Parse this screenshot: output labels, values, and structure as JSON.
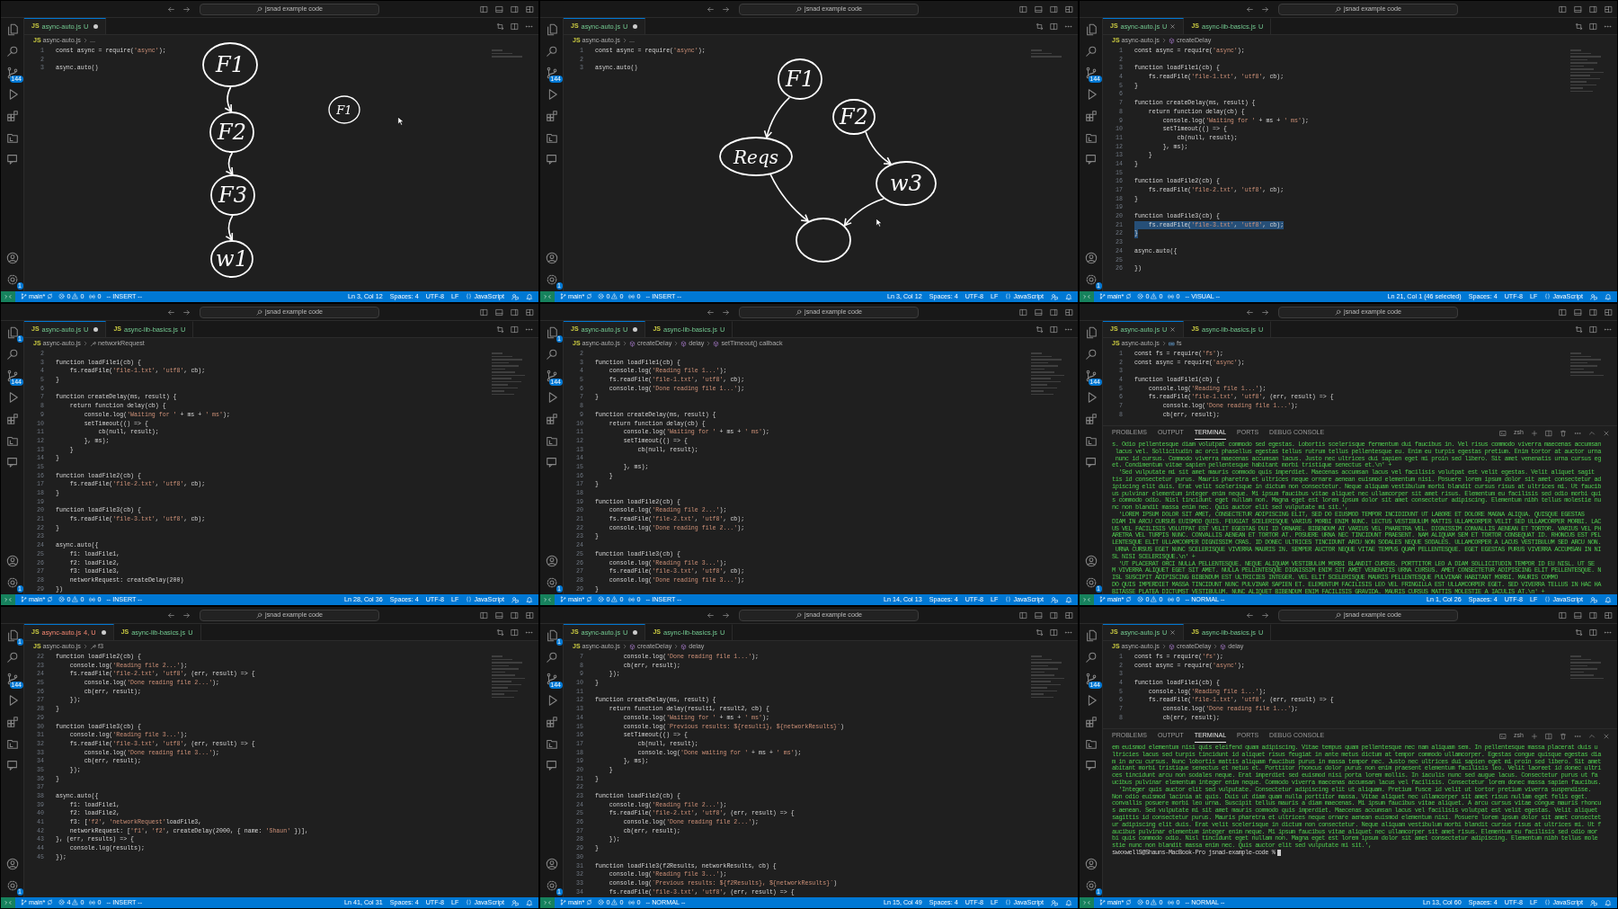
{
  "window": {
    "titles": [
      "jsnad example code",
      "jsnad example code",
      "jsnad example code",
      "jsnad example code",
      "jsnad example code",
      "jsnad example code",
      "jsnad example code",
      "jsnad example code",
      "jsnad example code"
    ]
  },
  "panels": [
    {
      "tabs": [
        {
          "icon": "JS",
          "label": "async-auto.js",
          "status": "U",
          "kind": "untracked",
          "selected": true,
          "dirty": true
        }
      ],
      "breadcrumb": [
        {
          "kind": "file",
          "icon": "JS",
          "label": "async-auto.js"
        },
        {
          "kind": "plain",
          "label": "..."
        }
      ],
      "badges": {
        "scm": "144",
        "settings": "1"
      },
      "lines": [
        [
          "1",
          "const async = require('async');"
        ],
        [
          "2"
        ],
        [
          "3",
          "async.auto()"
        ]
      ],
      "drawing": {
        "nodes": [
          {
            "kind": "big",
            "label": "F1"
          },
          {
            "kind": "big",
            "label": "F2"
          },
          {
            "kind": "big",
            "label": "F3"
          },
          {
            "kind": "big",
            "label": "w1"
          },
          {
            "kind": "small",
            "label": "F1"
          }
        ],
        "edges": [
          {
            "kind": "arrow"
          },
          {
            "kind": "arrow"
          },
          {
            "kind": "arrow"
          }
        ]
      },
      "status": {
        "branch": "main*",
        "errors": "0",
        "warnings": "0",
        "ports": "0",
        "mode": "-- INSERT --",
        "position": "Ln 3, Col 12",
        "spaces": "Spaces: 4",
        "encoding": "UTF-8",
        "eol": "LF",
        "language": "JavaScript"
      }
    },
    {
      "tabs": [
        {
          "icon": "JS",
          "label": "async-auto.js",
          "status": "U",
          "kind": "untracked",
          "selected": true,
          "dirty": true
        }
      ],
      "breadcrumb": [
        {
          "kind": "file",
          "icon": "JS",
          "label": "async-auto.js"
        },
        {
          "kind": "plain",
          "label": "..."
        }
      ],
      "badges": {
        "scm": "144",
        "settings": "1"
      },
      "lines": [
        [
          "1",
          "const async = require('async');"
        ],
        [
          "2"
        ],
        [
          "3",
          "async.auto()"
        ]
      ],
      "drawing": {
        "nodes": [
          {
            "kind": "big",
            "label": "F1"
          },
          {
            "kind": "big",
            "label": "F2"
          },
          {
            "kind": "big",
            "label": "Reqs"
          },
          {
            "kind": "big",
            "label": "w3"
          },
          {
            "kind": "empty"
          }
        ],
        "edges": [
          {
            "kind": "arrow"
          },
          {
            "kind": "arrow"
          },
          {
            "kind": "arrow"
          },
          {
            "kind": "arrow"
          }
        ]
      },
      "status": {
        "branch": "main*",
        "errors": "0",
        "warnings": "0",
        "ports": "0",
        "mode": "-- INSERT --",
        "position": "Ln 3, Col 12",
        "spaces": "Spaces: 4",
        "encoding": "UTF-8",
        "eol": "LF",
        "language": "JavaScript"
      }
    },
    {
      "tabs": [
        {
          "icon": "JS",
          "label": "async-auto.js",
          "status": "U",
          "kind": "untracked",
          "selected": true,
          "dirty": false
        },
        {
          "icon": "JS",
          "label": "async-lib-basics.js",
          "status": "U",
          "kind": "untracked",
          "selected": false,
          "dirty": false
        }
      ],
      "breadcrumb": [
        {
          "kind": "file",
          "icon": "JS",
          "label": "async-auto.js"
        },
        {
          "kind": "function",
          "label": "createDelay"
        }
      ],
      "badges": {
        "scm": "144",
        "settings": "1"
      },
      "lines": [
        [
          "1",
          "const async = require('async');"
        ],
        [
          "2"
        ],
        [
          "3",
          "function loadFile1(cb) {"
        ],
        [
          "4",
          "    fs.readFile('file-1.txt', 'utf8', cb);"
        ],
        [
          "5",
          "}"
        ],
        [
          "6"
        ],
        [
          "7",
          "function createDelay(ms, result) {"
        ],
        [
          "8",
          "    return function delay(cb) {"
        ],
        [
          "9",
          "        console.log('Waiting for ' + ms + ' ms');"
        ],
        [
          "10",
          "        setTimeout(() => {"
        ],
        [
          "11",
          "            cb(null, result);"
        ],
        [
          "12",
          "        }, ms);"
        ],
        [
          "13",
          "    }"
        ],
        [
          "14",
          "}"
        ],
        [
          "15"
        ],
        [
          "16",
          "function loadFile2(cb) {"
        ],
        [
          "17",
          "    fs.readFile('file-2.txt', 'utf8', cb);"
        ],
        [
          "18",
          "}"
        ],
        [
          "19"
        ],
        [
          "20",
          "function loadFile3(cb) {"
        ],
        [
          "21",
          "    fs.readFile('file-3.txt', 'utf8', cb);",
          true
        ],
        [
          "22",
          "}",
          true
        ],
        [
          "23"
        ],
        [
          "24",
          "async.auto({"
        ],
        [
          "25"
        ],
        [
          "26",
          "})"
        ]
      ],
      "status": {
        "branch": "main*",
        "errors": "0",
        "warnings": "0",
        "ports": "0",
        "mode": "-- VISUAL --",
        "position": "Ln 21, Col 1 (46 selected)",
        "spaces": "Spaces: 4",
        "encoding": "UTF-8",
        "eol": "LF",
        "language": "JavaScript"
      }
    },
    {
      "tabs": [
        {
          "icon": "JS",
          "label": "async-auto.js",
          "status": "U",
          "kind": "untracked",
          "selected": true,
          "dirty": true
        },
        {
          "icon": "JS",
          "label": "async-lib-basics.js",
          "status": "U",
          "kind": "untracked",
          "selected": false,
          "dirty": false
        }
      ],
      "breadcrumb": [
        {
          "kind": "file",
          "icon": "JS",
          "label": "async-auto.js"
        },
        {
          "kind": "property",
          "label": "networkRequest"
        }
      ],
      "badges": {
        "explorer": "1",
        "scm": "144",
        "settings": "1"
      },
      "lines": [
        [
          "2"
        ],
        [
          "3",
          "function loadFile1(cb) {"
        ],
        [
          "4",
          "    fs.readFile('file-1.txt', 'utf8', cb);"
        ],
        [
          "5",
          "}"
        ],
        [
          "6"
        ],
        [
          "7",
          "function createDelay(ms, result) {"
        ],
        [
          "8",
          "    return function delay(cb) {"
        ],
        [
          "9",
          "        console.log('Waiting for ' + ms + ' ms');"
        ],
        [
          "10",
          "        setTimeout(() => {"
        ],
        [
          "11",
          "            cb(null, result);"
        ],
        [
          "12",
          "        }, ms);"
        ],
        [
          "13",
          "    }"
        ],
        [
          "14",
          "}"
        ],
        [
          "15"
        ],
        [
          "16",
          "function loadFile2(cb) {"
        ],
        [
          "17",
          "    fs.readFile('file-2.txt', 'utf8', cb);"
        ],
        [
          "18",
          "}"
        ],
        [
          "19"
        ],
        [
          "20",
          "function loadFile3(cb) {"
        ],
        [
          "21",
          "    fs.readFile('file-3.txt', 'utf8', cb);"
        ],
        [
          "22",
          "}"
        ],
        [
          "23"
        ],
        [
          "24",
          "async.auto({"
        ],
        [
          "25",
          "    f1: loadFile1,"
        ],
        [
          "26",
          "    f2: loadFile2,"
        ],
        [
          "27",
          "    f3: loadFile3,"
        ],
        [
          "28",
          "    networkRequest: createDelay(200)"
        ],
        [
          "29",
          "})"
        ]
      ],
      "status": {
        "branch": "main*",
        "errors": "0",
        "warnings": "0",
        "ports": "0",
        "mode": "-- INSERT --",
        "position": "Ln 28, Col 36",
        "spaces": "Spaces: 4",
        "encoding": "UTF-8",
        "eol": "LF",
        "language": "JavaScript"
      }
    },
    {
      "tabs": [
        {
          "icon": "JS",
          "label": "async-auto.js",
          "status": "U",
          "kind": "untracked",
          "selected": true,
          "dirty": true
        },
        {
          "icon": "JS",
          "label": "async-lib-basics.js",
          "status": "U",
          "kind": "untracked",
          "selected": false,
          "dirty": false
        }
      ],
      "breadcrumb": [
        {
          "kind": "file",
          "icon": "JS",
          "label": "async-auto.js"
        },
        {
          "kind": "function",
          "label": "createDelay"
        },
        {
          "kind": "function",
          "label": "delay"
        },
        {
          "kind": "function",
          "label": "setTimeout() callback"
        }
      ],
      "badges": {
        "explorer": "1",
        "scm": "144",
        "settings": "1"
      },
      "lines": [
        [
          "2"
        ],
        [
          "3",
          "function loadFile1(cb) {"
        ],
        [
          "4",
          "    console.log('Reading file 1...');"
        ],
        [
          "5",
          "    fs.readFile('file-1.txt', 'utf8', cb);"
        ],
        [
          "6",
          "    console.log('Done reading file 1...');"
        ],
        [
          "7",
          "}"
        ],
        [
          "8"
        ],
        [
          "9",
          "function createDelay(ms, result) {"
        ],
        [
          "10",
          "    return function delay(cb) {"
        ],
        [
          "11",
          "        console.log('Waiting for ' + ms + ' ms');"
        ],
        [
          "12",
          "        setTimeout(() => {"
        ],
        [
          "13",
          "            cb(null, result);"
        ],
        [
          "14"
        ],
        [
          "15",
          "        }, ms);"
        ],
        [
          "16",
          "    }"
        ],
        [
          "17",
          "}"
        ],
        [
          "18"
        ],
        [
          "19",
          "function loadFile2(cb) {"
        ],
        [
          "20",
          "    console.log('Reading file 2...');"
        ],
        [
          "21",
          "    fs.readFile('file-2.txt', 'utf8', cb);"
        ],
        [
          "22",
          "    console.log('Done reading file 2...');"
        ],
        [
          "23",
          "}"
        ],
        [
          "24"
        ],
        [
          "25",
          "function loadFile3(cb) {"
        ],
        [
          "26",
          "    console.log('Reading file 3...');"
        ],
        [
          "27",
          "    fs.readFile('file-3.txt', 'utf8', cb);"
        ],
        [
          "28",
          "    console.log('Done reading file 3...');"
        ],
        [
          "29",
          "}"
        ]
      ],
      "status": {
        "branch": "main*",
        "errors": "0",
        "warnings": "0",
        "ports": "0",
        "mode": "-- INSERT --",
        "position": "Ln 14, Col 13",
        "spaces": "Spaces: 4",
        "encoding": "UTF-8",
        "eol": "LF",
        "language": "JavaScript"
      }
    },
    {
      "tabs": [
        {
          "icon": "JS",
          "label": "async-auto.js",
          "status": "U",
          "kind": "untracked",
          "selected": true,
          "dirty": false
        },
        {
          "icon": "JS",
          "label": "async-lib-basics.js",
          "status": "U",
          "kind": "untracked",
          "selected": false,
          "dirty": false
        }
      ],
      "breadcrumb": [
        {
          "kind": "file",
          "icon": "JS",
          "label": "async-auto.js"
        },
        {
          "kind": "variable",
          "label": "fs"
        }
      ],
      "badges": {
        "scm": "144",
        "settings": "1"
      },
      "lines": [
        [
          "1",
          "const fs = require('fs');"
        ],
        [
          "2",
          "const async = require('async');"
        ],
        [
          "3"
        ],
        [
          "4",
          "function loadFile1(cb) {"
        ],
        [
          "5",
          "    console.log('Reading file 1...');"
        ],
        [
          "6",
          "    fs.readFile('file-1.txt', 'utf8', (err, result) => {"
        ],
        [
          "7",
          "        console.log('Done reading file 1...');"
        ],
        [
          "8",
          "        cb(err, result);"
        ]
      ],
      "terminal": {
        "tabs": [
          {
            "label": "PROBLEMS",
            "selected": false
          },
          {
            "label": "OUTPUT",
            "selected": false
          },
          {
            "label": "TERMINAL",
            "selected": true
          },
          {
            "label": "PORTS",
            "selected": false
          },
          {
            "label": "DEBUG CONSOLE",
            "selected": false
          }
        ],
        "shell": "zsh",
        "lines": [
          "s. Odio pellentesque diam volutpat commodo sed egestas. Lobortis scelerisque fermentum dui faucibus in. Vel risus commodo viverra maecenas accumsan",
          " lacus vel. Sollicitudin ac orci phasellus egestas tellus rutrum tellus pellentesque eu. Enim eu turpis egestas pretium. Enim tortor at auctor urna",
          " nunc id cursus. Commodo viverra maecenas accumsan lacus. Justo nec ultrices dui sapien eget mi proin sed libero. Sit amet venenatis urna cursus eg",
          "et. Condimentum vitae sapien pellentesque habitant morbi tristique senectus et.\\n' +",
          "  'Sed vulputate mi sit amet mauris commodo quis imperdiet. Maecenas accumsan lacus vel facilisis volutpat est velit egestas. Velit aliquet sagit",
          "tis id consectetur purus. Mauris pharetra et ultrices neque ornare aenean euismod elementum nisi. Posuere lorem ipsum dolor sit amet consectetur ad",
          "ipiscing elit duis. Erat velit scelerisque in dictum non consectetur. Neque aliquam vestibulum morbi blandit cursus risus at ultrices mi. Ut faucib",
          "us pulvinar elementum integer enim neque. Mi ipsum faucibus vitae aliquet nec ullamcorper sit amet risus. Elementum eu facilisis sed odio morbi qui",
          "s commodo odio. Nisl tincidunt eget nullam non. Magna eget est lorem ipsum dolor sit amet consectetur adipiscing. Elementum nibh tellus molestie nu",
          "nc non blandit massa enim nec. Quis auctor elit sed vulputate mi sit.',",
          "  'LOREM IPSUM DOLOR SIT AMET, CONSECTETUR ADIPISCING ELIT, SED DO EIUSMOD TEMPOR INCIDIDUNT UT LABORE ET DOLORE MAGNA ALIQUA. QUISQUE EGESTAS",
          "DIAM IN ARCU CURSUS EUISMOD QUIS. FEUGIAT SCELERISQUE VARIUS MORBI ENIM NUNC. LECTUS VESTIBULUM MATTIS ULLAMCORPER VELIT SED ULLAMCORPER MORBI. LAC",
          "US VEL FACILISIS VOLUTPAT EST VELIT EGESTAS DUI ID ORNARE. BIBENDUM AT VARIUS VEL PHARETRA VEL. DIGNISSIM CONVALLIS AENEAN ET TORTOR. VARIUS VEL PH",
          "ARETRA VEL TURPIS NUNC. CONVALLIS AENEAN ET TORTOR AT. POSUERE URNA NEC TINCIDUNT PRAESENT. NAM ALIQUAM SEM ET TORTOR CONSEQUAT ID. RHONCUS EST PEL",
          "LENTESQUE ELIT ULLAMCORPER DIGNISSIM CRAS. ID DONEC ULTRICES TINCIDUNT ARCU NON SODALES NEQUE SODALES. ULLAMCORPER A LACUS VESTIBULUM SED ARCU NON.",
          " URNA CURSUS EGET NUNC SCELERISQUE VIVERRA MAURIS IN. SEMPER AUCTOR NEQUE VITAE TEMPUS QUAM PELLENTESQUE. EGET EGESTAS PURUS VIVERRA ACCUMSAN IN NI",
          "SL NISI SCELERISQUE.\\n' +",
          "  'UT PLACERAT ORCI NULLA PELLENTESQUE. NEQUE ALIQUAM VESTIBULUM MORBI BLANDIT CURSUS. PORTTITOR LEO A DIAM SOLLICITUDIN TEMPOR ID EU NISL. UT SE",
          "M VIVERRA ALIQUET EGET SIT AMET. NULLA PELLENTESQUE DIGNISSIM ENIM SIT AMET VENENATIS URNA CURSUS. AMET CONSECTETUR ADIPISCING ELIT PELLENTESQUE. N",
          "ISL SUSCIPIT ADIPISCING BIBENDUM EST ULTRICIES INTEGER. VEL ELIT SCELERISQUE MAURIS PELLENTESQUE PULVINAR HABITANT MORBI. MAURIS COMMO",
          "DO QUIS IMPERDIET MASSA TINCIDUNT NUNC PULVINAR SAPIEN ET. ELEMENTUM FACILISIS LEO VEL FRINGILLA EST ULLAMCORPER EGET. SED VIVERRA TELLUS IN HAC HA",
          "BITASSE PLATEA DICTUMST VESTIBULUM. NUNC ALIQUET BIBENDUM ENIM FACILISIS GRAVIDA. MAURIS CURSUS MATTIS MOLESTIE A IACULIS AT.\\n' +"
        ]
      },
      "status": {
        "branch": "main*",
        "errors": "0",
        "warnings": "0",
        "ports": "0",
        "mode": "-- NORMAL --",
        "position": "Ln 1, Col 26",
        "spaces": "Spaces: 4",
        "encoding": "UTF-8",
        "eol": "LF",
        "language": "JavaScript"
      }
    },
    {
      "tabs": [
        {
          "icon": "JS",
          "label": "async-auto.js",
          "status": "4, U",
          "kind": "error",
          "selected": true,
          "dirty": true
        },
        {
          "icon": "JS",
          "label": "async-lib-basics.js",
          "status": "U",
          "kind": "untracked",
          "selected": false,
          "dirty": false
        }
      ],
      "breadcrumb": [
        {
          "kind": "file",
          "icon": "JS",
          "label": "async-auto.js"
        },
        {
          "kind": "property",
          "label": "f3"
        }
      ],
      "badges": {
        "explorer": "1",
        "scm": "144",
        "settings": "1"
      },
      "lines": [
        [
          "22",
          "function loadFile2(cb) {"
        ],
        [
          "23",
          "    console.log('Reading file 2...');"
        ],
        [
          "24",
          "    fs.readFile('file-2.txt', 'utf8', (err, result) => {"
        ],
        [
          "25",
          "        console.log('Done reading file 2...');"
        ],
        [
          "26",
          "        cb(err, result);"
        ],
        [
          "27",
          "    });"
        ],
        [
          "28",
          "}"
        ],
        [
          "29"
        ],
        [
          "30",
          "function loadFile3(cb) {"
        ],
        [
          "31",
          "    console.log('Reading file 3...');"
        ],
        [
          "32",
          "    fs.readFile('file-3.txt', 'utf8', (err, result) => {"
        ],
        [
          "33",
          "        console.log('Done reading file 3...');"
        ],
        [
          "34",
          "        cb(err, result);"
        ],
        [
          "35",
          "    });"
        ],
        [
          "36",
          "}"
        ],
        [
          "37"
        ],
        [
          "38",
          "async.auto({"
        ],
        [
          "39",
          "    f1: loadFile1,"
        ],
        [
          "40",
          "    f2: loadFile2,"
        ],
        [
          "41",
          "    f3: ['f2', 'networkRequest'loadFile3,"
        ],
        [
          "42",
          "    networkRequest: ['f1', 'f2', createDelay(2000, { name: 'Shaun' })],"
        ],
        [
          "43",
          "}, (err, results) => {"
        ],
        [
          "44",
          "    console.log(results);"
        ],
        [
          "45",
          "});"
        ]
      ],
      "status": {
        "branch": "main*",
        "errors": "4",
        "warnings": "0",
        "ports": "0",
        "mode": "-- INSERT --",
        "position": "Ln 41, Col 31",
        "spaces": "Spaces: 4",
        "encoding": "UTF-8",
        "eol": "LF",
        "language": "JavaScript"
      }
    },
    {
      "tabs": [
        {
          "icon": "JS",
          "label": "async-auto.js",
          "status": "U",
          "kind": "untracked",
          "selected": true,
          "dirty": true
        },
        {
          "icon": "JS",
          "label": "async-lib-basics.js",
          "status": "U",
          "kind": "untracked",
          "selected": false,
          "dirty": false
        }
      ],
      "breadcrumb": [
        {
          "kind": "file",
          "icon": "JS",
          "label": "async-auto.js"
        },
        {
          "kind": "function",
          "label": "createDelay"
        },
        {
          "kind": "function",
          "label": "delay"
        }
      ],
      "badges": {
        "explorer": "1",
        "scm": "144",
        "settings": "1"
      },
      "lines": [
        [
          "7",
          "        console.log('Done reading file 1...');"
        ],
        [
          "8",
          "        cb(err, result);"
        ],
        [
          "9",
          "    });"
        ],
        [
          "10",
          "}"
        ],
        [
          "11"
        ],
        [
          "12",
          "function createDelay(ms, result) {"
        ],
        [
          "13",
          "    return function delay(result1, result2, cb) {"
        ],
        [
          "14",
          "        console.log('Waiting for ' + ms + ' ms');"
        ],
        [
          "15",
          "        console.log(`Previous results: ${result1}, ${networkResults}`)"
        ],
        [
          "16",
          "        setTimeout(() => {"
        ],
        [
          "17",
          "            cb(null, result);"
        ],
        [
          "18",
          "            console.log('Done waiting for ' + ms + ' ms');"
        ],
        [
          "19",
          "        }, ms);"
        ],
        [
          "20",
          "    }"
        ],
        [
          "21",
          "}"
        ],
        [
          "22"
        ],
        [
          "23",
          "function loadFile2(cb) {"
        ],
        [
          "24",
          "    console.log('Reading file 2...');"
        ],
        [
          "25",
          "    fs.readFile('file-2.txt', 'utf8', (err, result) => {"
        ],
        [
          "26",
          "        console.log('Done reading file 2...');"
        ],
        [
          "27",
          "        cb(err, result);"
        ],
        [
          "28",
          "    });"
        ],
        [
          "29",
          "}"
        ],
        [
          "30"
        ],
        [
          "31",
          "function loadFile3(f2Results, networkResults, cb) {"
        ],
        [
          "32",
          "    console.log('Reading file 3...');"
        ],
        [
          "33",
          "    console.log(`Previous results: ${f2Results}, ${networkResults}`)"
        ],
        [
          "34",
          "    fs.readFile('file-3.txt', 'utf8', (err, result) => {"
        ]
      ],
      "status": {
        "branch": "main*",
        "errors": "0",
        "warnings": "0",
        "ports": "0",
        "mode": "-- NORMAL --",
        "position": "Ln 15, Col 49",
        "spaces": "Spaces: 4",
        "encoding": "UTF-8",
        "eol": "LF",
        "language": "JavaScript"
      }
    },
    {
      "tabs": [
        {
          "icon": "JS",
          "label": "async-auto.js",
          "status": "U",
          "kind": "untracked",
          "selected": true,
          "dirty": false
        },
        {
          "icon": "JS",
          "label": "async-lib-basics.js",
          "status": "U",
          "kind": "untracked",
          "selected": false,
          "dirty": false
        }
      ],
      "breadcrumb": [
        {
          "kind": "file",
          "icon": "JS",
          "label": "async-auto.js"
        },
        {
          "kind": "function",
          "label": "createDelay"
        },
        {
          "kind": "function",
          "label": "delay"
        }
      ],
      "badges": {
        "scm": "144",
        "settings": "1"
      },
      "lines": [
        [
          "1",
          "const fs = require('fs');"
        ],
        [
          "2",
          "const async = require('async');"
        ],
        [
          "3"
        ],
        [
          "4",
          "function loadFile1(cb) {"
        ],
        [
          "5",
          "    console.log('Reading file 1...');"
        ],
        [
          "6",
          "    fs.readFile('file-1.txt', 'utf8', (err, result) => {"
        ],
        [
          "7",
          "        console.log('Done reading file 1...');"
        ],
        [
          "8",
          "        cb(err, result);"
        ]
      ],
      "terminal": {
        "tabs": [
          {
            "label": "PROBLEMS",
            "selected": false
          },
          {
            "label": "OUTPUT",
            "selected": false
          },
          {
            "label": "TERMINAL",
            "selected": true
          },
          {
            "label": "PORTS",
            "selected": false
          },
          {
            "label": "DEBUG CONSOLE",
            "selected": false
          }
        ],
        "shell": "zsh",
        "lines": [
          "em euismod elementum nisi quis eleifend quam adipiscing. Vitae tempus quam pellentesque nec nam aliquam sem. In pellentesque massa placerat duis u",
          "ltricies lacus sed turpis tincidunt id aliquet risus feugiat in ante metus dictum at tempor commodo ullamcorper. Egestas congue quisque egestas dia",
          "m in arcu cursus. Nunc lobortis mattis aliquam faucibus purus in massa tempor nec. Justo nec ultrices dui sapien eget mi proin sed libero. Sit amet",
          "abitant morbi tristique senectus et netus et. Porttitor rhoncus dolor purus non enim praesent elementum facilisis leo. Velit laoreet id donec ultri",
          "ces tincidunt arcu non sodales neque. Erat imperdiet sed euismod nisi porta lorem mollis. In iaculis nunc sed augue lacus. Consectetur purus ut fa",
          "ucibus pulvinar elementum integer enim neque. Commodo viverra maecenas accumsan lacus vel facilisis. Consectetur lorem donec massa sapien faucibus.",
          "  'Integer quis auctor elit sed vulputate. Consectetur adipiscing elit ut aliquam. Pretium fusce id velit ut tortor pretium viverra suspendisse.",
          "Non odio euismod lacinia at quis. Duis ut diam quam nulla porttitor massa. Vitae aliquet nec ullamcorper sit amet risus nullam eget felis eget.",
          "convallis posuere morbi leo urna. Suscipit tellus mauris a diam maecenas. Mi ipsum faucibus vitae aliquet. A arcu cursus vitae congue mauris rhoncu",
          "s aenean. Sed vulputate mi sit amet mauris commodo quis imperdiet. Maecenas accumsan lacus vel facilisis volutpat est velit egestas. Velit aliquet",
          "sagittis id consectetur purus. Mauris pharetra et ultrices neque ornare aenean euismod elementum nisi. Posuere lorem ipsum dolor sit amet consectet",
          "ur adipiscing elit duis. Erat velit scelerisque in dictum non consectetur. Neque aliquam vestibulum morbi blandit cursus risus at ultrices mi. Ut f",
          "aucibus pulvinar elementum integer enim neque. Mi ipsum faucibus vitae aliquet nec ullamcorper sit amet risus. Elementum eu facilisis sed odio mor",
          "bi quis commodo odio. Nisl tincidunt eget nullam non. Magna eget est lorem ipsum dolor sit amet consectetur adipiscing. Elementum nibh tellus mole",
          "stie nunc non blandit massa enim nec. Quis auctor elit sed vulputate mi sit.',"
        ],
        "prompt": "swxxwellS@Shauns-MacBook-Pro jsnad-example-code %"
      },
      "status": {
        "branch": "main*",
        "errors": "0",
        "warnings": "0",
        "ports": "0",
        "mode": "-- NORMAL --",
        "position": "Ln 13, Col 60",
        "spaces": "Spaces: 4",
        "encoding": "UTF-8",
        "eol": "LF",
        "language": "JavaScript"
      }
    }
  ]
}
